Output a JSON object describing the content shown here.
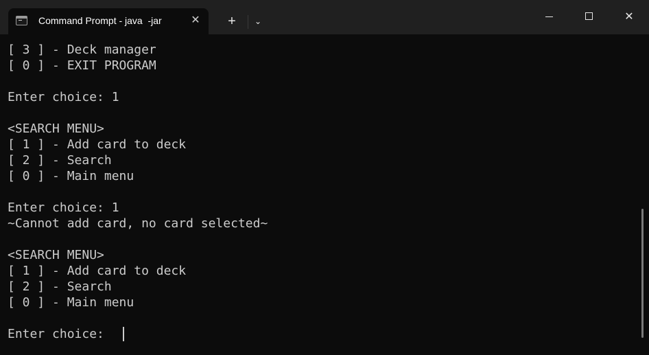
{
  "titlebar": {
    "tab_title": "Command Prompt - java  -jar",
    "tab_icon": "terminal-icon",
    "close_tab_glyph": "✕",
    "new_tab_glyph": "+",
    "dropdown_glyph": "⌄",
    "close_window_glyph": "✕"
  },
  "terminal": {
    "lines": [
      "[ 3 ] - Deck manager",
      "[ 0 ] - EXIT PROGRAM",
      "",
      "Enter choice: 1",
      "",
      "<SEARCH MENU>",
      "[ 1 ] - Add card to deck",
      "[ 2 ] - Search",
      "[ 0 ] - Main menu",
      "",
      "Enter choice: 1",
      "~Cannot add card, no card selected~",
      "",
      "<SEARCH MENU>",
      "[ 1 ] - Add card to deck",
      "[ 2 ] - Search",
      "[ 0 ] - Main menu",
      "",
      "Enter choice: "
    ]
  },
  "colors": {
    "background": "#0c0c0c",
    "titlebar": "#202020",
    "text": "#cccccc"
  }
}
